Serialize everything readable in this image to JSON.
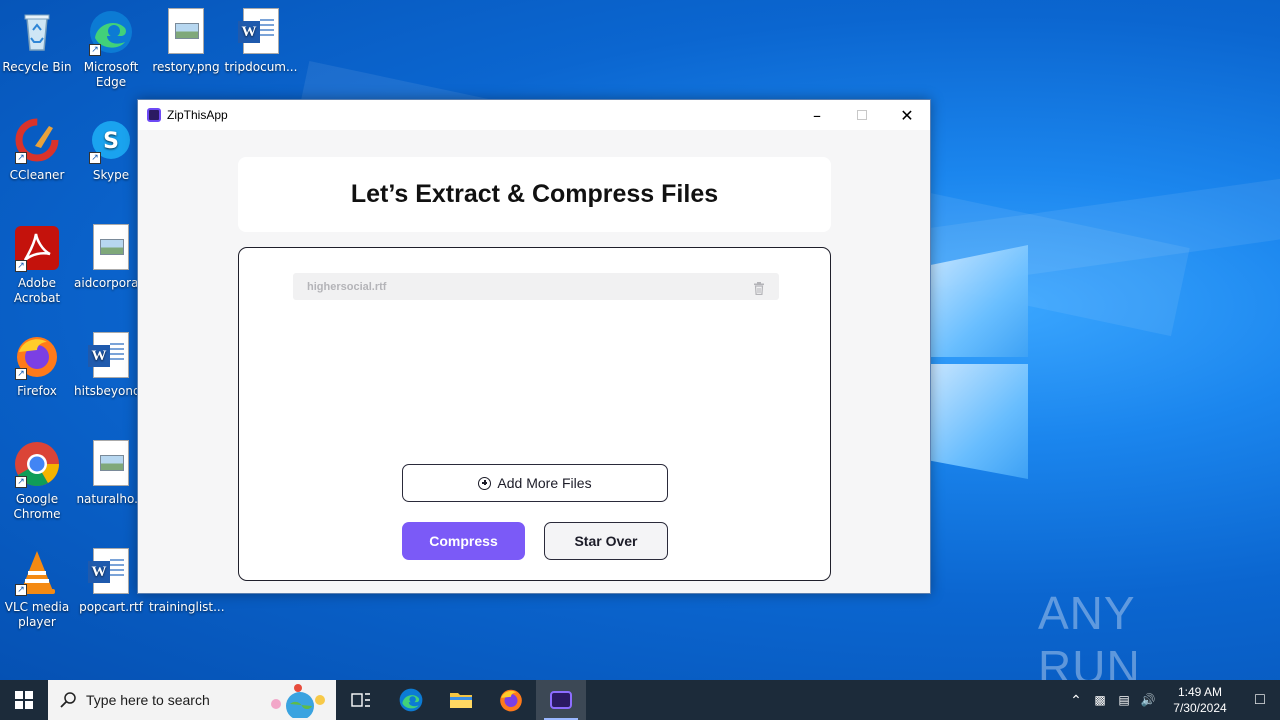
{
  "desktop": {
    "icons": [
      {
        "label": "Recycle Bin",
        "icon": "recycle-bin-icon"
      },
      {
        "label": "Microsoft Edge",
        "icon": "edge-icon"
      },
      {
        "label": "restory.png",
        "icon": "image-file-icon"
      },
      {
        "label": "tripdocum...",
        "icon": "word-file-icon"
      },
      {
        "label": "CCleaner",
        "icon": "ccleaner-icon"
      },
      {
        "label": "Skype",
        "icon": "skype-icon"
      },
      {
        "label": "Adobe Acrobat",
        "icon": "acrobat-icon"
      },
      {
        "label": "aidcorporat...",
        "icon": "image-file-icon"
      },
      {
        "label": "Firefox",
        "icon": "firefox-icon"
      },
      {
        "label": "hitsbeyond...",
        "icon": "word-file-icon"
      },
      {
        "label": "Google Chrome",
        "icon": "chrome-icon"
      },
      {
        "label": "naturalho...",
        "icon": "image-file-icon"
      },
      {
        "label": "VLC media player",
        "icon": "vlc-icon"
      },
      {
        "label": "popcart.rtf",
        "icon": "word-file-icon"
      },
      {
        "label": "traininglist...",
        "icon": "word-file-icon"
      }
    ],
    "watermark": "ANY RUN"
  },
  "window": {
    "title": "ZipThisApp",
    "heading": "Let’s Extract & Compress Files",
    "files": [
      {
        "name": "highersocial.rtf"
      }
    ],
    "add_more_label": "Add More Files",
    "compress_label": "Compress",
    "start_over_label": "Star Over"
  },
  "taskbar": {
    "search_placeholder": "Type here to search",
    "time": "1:49 AM",
    "date": "7/30/2024"
  },
  "colors": {
    "accent": "#7b5af7",
    "taskbar": "#1c2b3a",
    "desktop": "#0b66d0"
  }
}
